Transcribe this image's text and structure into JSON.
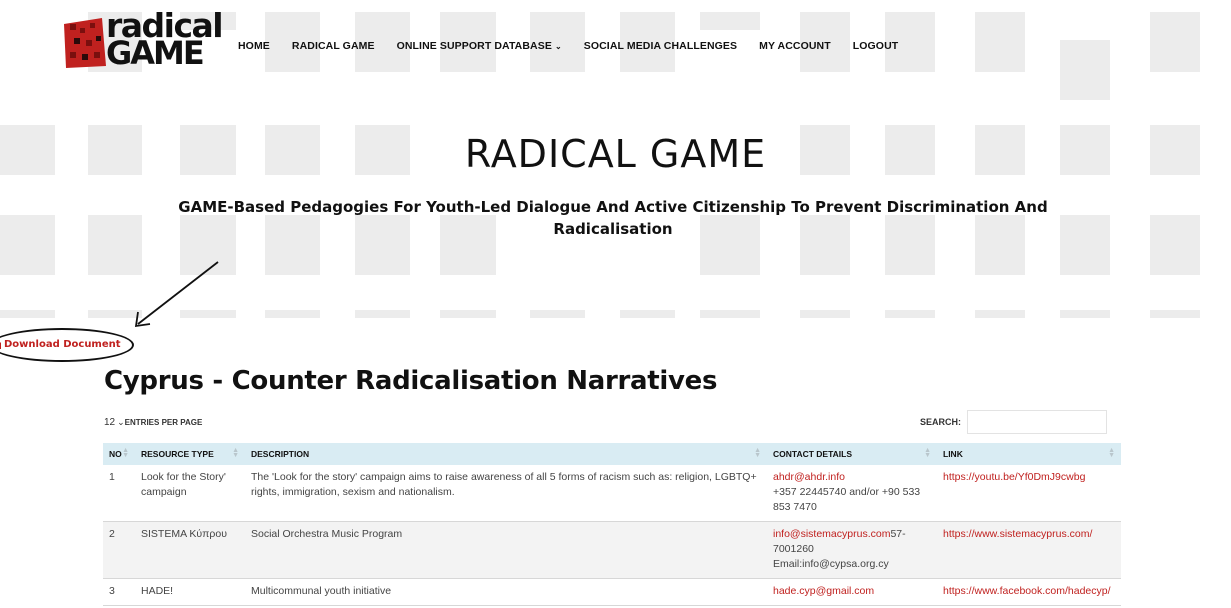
{
  "brand": {
    "logo_line1": "radical",
    "logo_line2": "GAME",
    "accent_color": "#c0211f"
  },
  "nav": {
    "items": [
      {
        "label": "HOME"
      },
      {
        "label": "RADICAL GAME"
      },
      {
        "label": "ONLINE SUPPORT DATABASE"
      },
      {
        "label": "SOCIAL MEDIA CHALLENGES"
      },
      {
        "label": "MY ACCOUNT"
      },
      {
        "label": "LOGOUT"
      }
    ],
    "dropdown_icon": "chevron-down-icon"
  },
  "hero": {
    "title": "RADICAL GAME",
    "subtitle": "GAME-Based Pedagogies For Youth-Led Dialogue And Active Citizenship To Prevent Discrimination And Radicalisation"
  },
  "download": {
    "label": "Download Document",
    "icon": "file-icon"
  },
  "page": {
    "heading": "Cyprus - Counter Radicalisation Narratives"
  },
  "table_controls": {
    "entries_value": "12",
    "entries_label": "ENTRIES PER PAGE",
    "search_label": "SEARCH:",
    "search_value": ""
  },
  "table": {
    "columns": [
      "NO",
      "RESOURCE TYPE",
      "DESCRIPTION",
      "CONTACT DETAILS",
      "LINK"
    ],
    "rows": [
      {
        "no": "1",
        "type": "Look for the Story' campaign",
        "description": "The 'Look for the story' campaign aims to raise awareness of all 5 forms of racism such as: religion, LGBTQ+ rights, immigration, sexism and nationalism.",
        "contact_email": "ahdr@ahdr.info",
        "contact_extra": "+357 22445740 and/or +90 533 853 7470",
        "link": "https://youtu.be/Yf0DmJ9cwbg"
      },
      {
        "no": "2",
        "type": "SISTEMA Κύπρου",
        "description": "Social Orchestra Music Program",
        "contact_email": "info@sistemacyprus.com",
        "contact_extra": "57-7001260 Email:info@cypsa.org.cy",
        "link": "https://www.sistemacyprus.com/"
      },
      {
        "no": "3",
        "type": "HADE!",
        "description": "Multicommunal youth initiative",
        "contact_email": "hade.cyp@gmail.com",
        "contact_extra": "",
        "link": "https://www.facebook.com/hadecyp/"
      }
    ]
  }
}
